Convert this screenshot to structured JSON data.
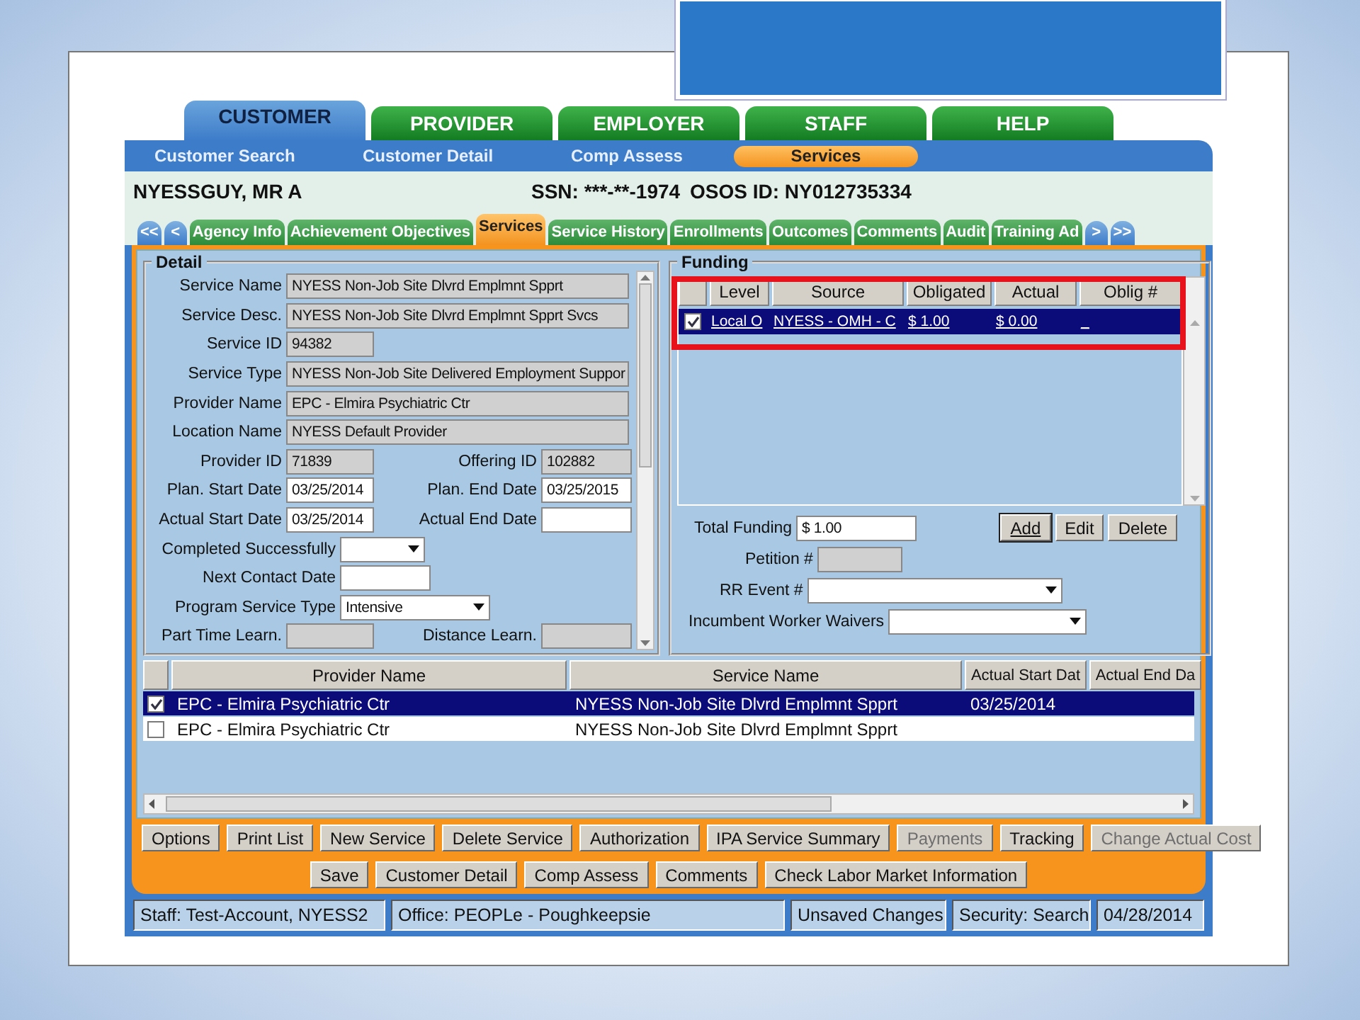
{
  "main_tabs": [
    {
      "label": "CUSTOMER",
      "selected": true
    },
    {
      "label": "PROVIDER",
      "selected": false
    },
    {
      "label": "EMPLOYER",
      "selected": false
    },
    {
      "label": "STAFF",
      "selected": false
    },
    {
      "label": "HELP",
      "selected": false
    }
  ],
  "sub_nav": [
    {
      "label": "Customer Search",
      "selected": false
    },
    {
      "label": "Customer Detail",
      "selected": false
    },
    {
      "label": "Comp Assess",
      "selected": false
    },
    {
      "label": "Services",
      "selected": true
    }
  ],
  "customer": {
    "name": "NYESSGUY, MR A",
    "ssn": "SSN: ***-**-1974",
    "osos_id": "OSOS ID: NY012735334"
  },
  "section_tabs": [
    {
      "label": "<<",
      "kind": "nav"
    },
    {
      "label": "<",
      "kind": "nav"
    },
    {
      "label": "Agency Info",
      "kind": "tab",
      "selected": false
    },
    {
      "label": "Achievement Objectives",
      "kind": "tab",
      "selected": false
    },
    {
      "label": "Services",
      "kind": "tab",
      "selected": true
    },
    {
      "label": "Service History",
      "kind": "tab",
      "selected": false
    },
    {
      "label": "Enrollments",
      "kind": "tab",
      "selected": false
    },
    {
      "label": "Outcomes",
      "kind": "tab",
      "selected": false
    },
    {
      "label": "Comments",
      "kind": "tab",
      "selected": false
    },
    {
      "label": "Audit",
      "kind": "tab",
      "selected": false
    },
    {
      "label": "Training Ad",
      "kind": "tab",
      "selected": false
    },
    {
      "label": ">",
      "kind": "nav"
    },
    {
      "label": ">>",
      "kind": "nav"
    }
  ],
  "detail": {
    "legend": "Detail",
    "rows": [
      {
        "kind": "full",
        "fields": [
          {
            "label": "Service Name",
            "kind": "readonly",
            "value": "NYESS Non-Job Site Dlvrd Emplmnt Spprt"
          }
        ]
      },
      {
        "kind": "full",
        "fields": [
          {
            "label": "Service Desc.",
            "kind": "readonly",
            "value": "NYESS Non-Job Site Dlvrd Emplmnt Spprt Svcs"
          }
        ]
      },
      {
        "kind": "short",
        "fields": [
          {
            "label": "Service ID",
            "kind": "readonly",
            "value": "94382"
          }
        ]
      },
      {
        "kind": "full",
        "fields": [
          {
            "label": "Service Type",
            "kind": "readonly",
            "value": "NYESS Non-Job Site Delivered Employment Suppor"
          }
        ]
      },
      {
        "kind": "full",
        "fields": [
          {
            "label": "Provider Name",
            "kind": "readonly",
            "value": "EPC - Elmira Psychiatric Ctr"
          }
        ]
      },
      {
        "kind": "full",
        "fields": [
          {
            "label": "Location Name",
            "kind": "readonly",
            "value": "NYESS Default Provider"
          }
        ]
      },
      {
        "kind": "pair",
        "fields": [
          {
            "label": "Provider ID",
            "kind": "readonly",
            "value": "71839"
          },
          {
            "label": "Offering ID",
            "kind": "readonly",
            "value": "102882"
          }
        ]
      },
      {
        "kind": "pair",
        "fields": [
          {
            "label": "Plan. Start Date",
            "kind": "text",
            "value": "03/25/2014"
          },
          {
            "label": "Plan. End Date",
            "kind": "text",
            "value": "03/25/2015"
          }
        ]
      },
      {
        "kind": "pair",
        "fields": [
          {
            "label": "Actual Start Date",
            "kind": "text",
            "value": "03/25/2014"
          },
          {
            "label": "Actual End Date",
            "kind": "text"
          }
        ]
      },
      {
        "kind": "inline",
        "fields": [
          {
            "label": "Completed Successfully",
            "kind": "dropdown"
          }
        ]
      },
      {
        "kind": "inline",
        "fields": [
          {
            "label": "Next Contact Date",
            "kind": "text"
          }
        ]
      },
      {
        "kind": "inline",
        "fields": [
          {
            "label": "Program Service Type",
            "kind": "dropdown",
            "value": "Intensive"
          }
        ]
      },
      {
        "kind": "pair",
        "fields": [
          {
            "label": "Part Time Learn.",
            "kind": "readonly"
          },
          {
            "label": "Distance Learn.",
            "kind": "readonly"
          }
        ]
      }
    ]
  },
  "funding": {
    "legend": "Funding",
    "highlighted": true,
    "columns": [
      "Level",
      "Source",
      "Obligated",
      "Actual",
      "Oblig #"
    ],
    "rows": [
      {
        "checked": true,
        "selected": true,
        "cells": [
          "Local O",
          "NYESS - OMH - C",
          "$ 1.00",
          "$ 0.00",
          "_"
        ]
      }
    ],
    "fields": [
      {
        "label": "Total Funding",
        "kind": "text",
        "value": "$ 1.00"
      },
      {
        "label": "Petition #",
        "kind": "readonly"
      },
      {
        "label": "RR Event #",
        "kind": "dropdown"
      },
      {
        "label": "Incumbent Worker Waivers",
        "kind": "dropdown"
      }
    ],
    "buttons": [
      {
        "label": "Add",
        "default": true
      },
      {
        "label": "Edit",
        "default": false
      },
      {
        "label": "Delete",
        "default": false
      }
    ]
  },
  "services_grid": {
    "columns": [
      "Provider Name",
      "Service Name",
      "Actual Start Dat",
      "Actual End Da"
    ],
    "rows": [
      {
        "checked": true,
        "selected": true,
        "cells": [
          "EPC - Elmira Psychiatric Ctr",
          "NYESS Non-Job Site Dlvrd Emplmnt Spprt",
          "03/25/2014",
          ""
        ]
      },
      {
        "checked": false,
        "selected": false,
        "cells": [
          "EPC - Elmira Psychiatric Ctr",
          "NYESS Non-Job Site Dlvrd Emplmnt Spprt",
          "",
          ""
        ]
      }
    ]
  },
  "action_buttons": [
    {
      "label": "Options",
      "disabled": false
    },
    {
      "label": "Print List",
      "disabled": false
    },
    {
      "label": "New Service",
      "disabled": false
    },
    {
      "label": "Delete Service",
      "disabled": false
    },
    {
      "label": "Authorization",
      "disabled": false
    },
    {
      "label": "IPA Service Summary",
      "disabled": false
    },
    {
      "label": "Payments",
      "disabled": true
    },
    {
      "label": "Tracking",
      "disabled": false
    },
    {
      "label": "Change Actual Cost",
      "disabled": true
    }
  ],
  "footer_buttons": [
    "Save",
    "Customer Detail",
    "Comp Assess",
    "Comments",
    "Check Labor Market Information"
  ],
  "status_bar": [
    "Staff: Test-Account, NYESS2",
    "Office: PEOPLe - Poughkeepsie",
    "Unsaved Changes",
    "Security: Search",
    "04/28/2014"
  ]
}
